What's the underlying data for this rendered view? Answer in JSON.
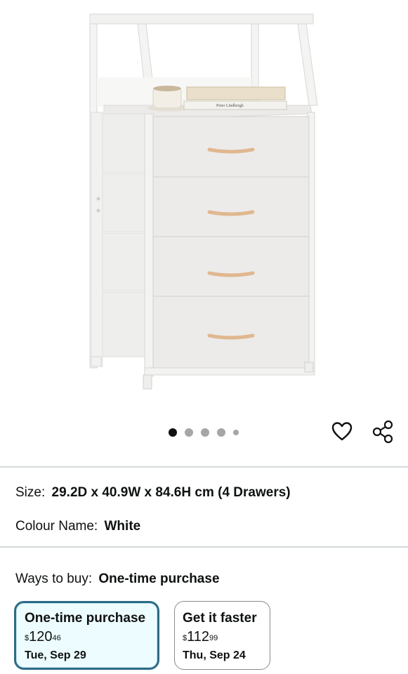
{
  "gallery": {
    "image_alt": "White 4-drawer fabric dresser with open top shelf",
    "shelf_book_text": "Peter Lindbergh",
    "dots_total": 5,
    "dots_active_index": 0
  },
  "details": {
    "size_label": "Size:",
    "size_value": "29.2D x 40.9W x 84.6H cm (4 Drawers)",
    "colour_label": "Colour Name:",
    "colour_value": "White"
  },
  "buy": {
    "ways_label": "Ways to buy:",
    "ways_value": "One-time purchase",
    "options": [
      {
        "title": "One-time purchase",
        "currency": "$",
        "price_whole": "120",
        "price_fraction": "46",
        "date": "Tue, Sep 29",
        "selected": true
      },
      {
        "title": "Get it faster",
        "currency": "$",
        "price_whole": "112",
        "price_fraction": "99",
        "date": "Thu, Sep 24",
        "selected": false
      }
    ]
  },
  "colors": {
    "selected_border": "#2d6b86",
    "selected_bg": "#edfdff",
    "active_dot": "#0f1111",
    "inactive_dot": "#a6a6a6"
  }
}
